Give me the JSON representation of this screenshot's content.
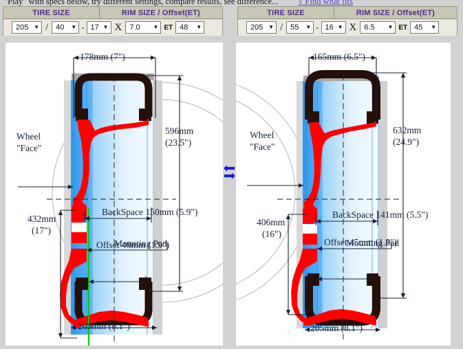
{
  "promo": {
    "text": "\"Play\" with specs below, try different settings, compare results, see difference...",
    "link_text": "√ Find what fits"
  },
  "spec_panels": [
    {
      "id": "left",
      "headers": {
        "tire": "TIRE SIZE",
        "rim": "RIM SIZE / Offset(ET)"
      },
      "tire_width": "205",
      "tire_aspect": "40",
      "rim_diameter": "17",
      "rim_width": "7.0",
      "et": "48",
      "sep_slash": "/",
      "sep_dash": "-",
      "sep_x": "X",
      "sep_et": "ET",
      "arrow": "▼"
    },
    {
      "id": "right",
      "headers": {
        "tire": "TIRE SIZE",
        "rim": "RIM SIZE / Offset(ET)"
      },
      "tire_width": "205",
      "tire_aspect": "55",
      "rim_diameter": "16",
      "rim_width": "6.5",
      "et": "45",
      "sep_slash": "/",
      "sep_dash": "-",
      "sep_x": "X",
      "sep_et": "ET",
      "arrow": "▼"
    }
  ],
  "diagrams": [
    {
      "id": "left-wheel",
      "rim_width_label": "178mm (7\")",
      "overall_diameter_label_1": "596mm",
      "overall_diameter_label_2": "(23.5\")",
      "wheel_face_label_1": "Wheel",
      "wheel_face_label_2": "\"Face\"",
      "backspace_label": "BackSpace 150mm (5.9\")",
      "mounting_pad_label": "Mounting Pad",
      "rim_diameter_label_1": "432mm",
      "rim_diameter_label_2": "(17\")",
      "offset_label": "Offset 48mm (1.9\")",
      "tire_width_label": "205mm (8.1\")"
    },
    {
      "id": "right-wheel",
      "rim_width_label": "165mm (6.5\")",
      "overall_diameter_label_1": "632mm",
      "overall_diameter_label_2": "(24.9\")",
      "wheel_face_label_1": "Wheel",
      "wheel_face_label_2": "\"Face\"",
      "backspace_label": "BackSpace 141mm (5.5\")",
      "mounting_pad_label": "Mounting Pad",
      "rim_diameter_label_1": "406mm",
      "rim_diameter_label_2": "(16\")",
      "offset_label": "Offset 45mm (1.8\")",
      "tire_width_label": "205mm (8.1\")"
    }
  ],
  "icons": {
    "swap": "swap-horizontal-arrows-icon"
  },
  "colors": {
    "header_bg": "#c8c6b4",
    "header_text": "#4b2d86",
    "page_bg": "#d2d2d2",
    "rim_red": "#ff0000",
    "tire_black": "#2b1810",
    "tire_gray": "#a8a8a8",
    "barrel_blue": "#3399ee",
    "center_line_green": "#00cc00",
    "swap_blue": "#1a1ae0"
  }
}
